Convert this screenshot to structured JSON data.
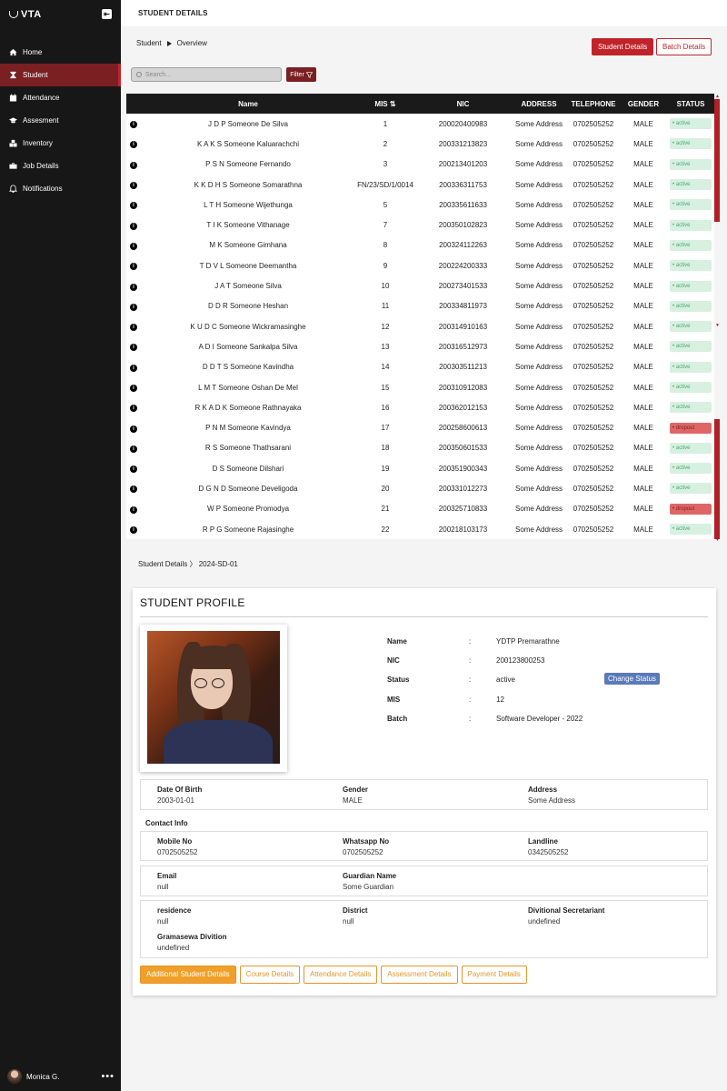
{
  "app": {
    "logo": "VTA"
  },
  "sidebar": {
    "items": [
      {
        "label": "Home",
        "icon": "home-icon"
      },
      {
        "label": "Student",
        "icon": "hourglass-icon"
      },
      {
        "label": "Attendance",
        "icon": "calendar-icon"
      },
      {
        "label": "Assesment",
        "icon": "graduation-cap-icon"
      },
      {
        "label": "Inventory",
        "icon": "boxes-icon"
      },
      {
        "label": "Job Details",
        "icon": "briefcase-icon"
      },
      {
        "label": "Notifications",
        "icon": "bell-icon"
      }
    ],
    "active_index": 1,
    "user": {
      "name": "Monica G.",
      "menu": "•••"
    }
  },
  "header": {
    "title": "STUDENT DETAILS"
  },
  "breadcrumb": {
    "root": "Student",
    "current": "Overview"
  },
  "toolbar": {
    "student_details_label": "Student Details",
    "batch_details_label": "Batch Details",
    "search_placeholder": "Search...",
    "filter_label": "Filter"
  },
  "table": {
    "columns": [
      "",
      "Name",
      "MIS ⇅",
      "NIC",
      "ADDRESS",
      "TELEPHONE",
      "GENDER",
      "STATUS"
    ],
    "rows": [
      {
        "name": "J D P Someone De Silva",
        "mis": "1",
        "nic": "200020400983",
        "address": "Some Address",
        "tel": "0702505252",
        "gender": "MALE",
        "status": "active"
      },
      {
        "name": "K A K S Someone Kaluarachchi",
        "mis": "2",
        "nic": "200331213823",
        "address": "Some Address",
        "tel": "0702505252",
        "gender": "MALE",
        "status": "active"
      },
      {
        "name": "P S N Someone Fernando",
        "mis": "3",
        "nic": "200213401203",
        "address": "Some Address",
        "tel": "0702505252",
        "gender": "MALE",
        "status": "active"
      },
      {
        "name": "K K D H S Someone Somarathna",
        "mis": "FN/23/SD/1/0014",
        "nic": "200336311753",
        "address": "Some Address",
        "tel": "0702505252",
        "gender": "MALE",
        "status": "active"
      },
      {
        "name": "L T H Someone Wijethunga",
        "mis": "5",
        "nic": "200335611633",
        "address": "Some Address",
        "tel": "0702505252",
        "gender": "MALE",
        "status": "active"
      },
      {
        "name": "T I K Someone Vithanage",
        "mis": "7",
        "nic": "200350102823",
        "address": "Some Address",
        "tel": "0702505252",
        "gender": "MALE",
        "status": "active"
      },
      {
        "name": "M K Someone Gimhana",
        "mis": "8",
        "nic": "200324112263",
        "address": "Some Address",
        "tel": "0702505252",
        "gender": "MALE",
        "status": "active"
      },
      {
        "name": "T D V L Someone Deemantha",
        "mis": "9",
        "nic": "200224200333",
        "address": "Some Address",
        "tel": "0702505252",
        "gender": "MALE",
        "status": "active"
      },
      {
        "name": "J A T Someone Silva",
        "mis": "10",
        "nic": "200273401533",
        "address": "Some Address",
        "tel": "0702505252",
        "gender": "MALE",
        "status": "active"
      },
      {
        "name": "D D R Someone Heshan",
        "mis": "11",
        "nic": "200334811973",
        "address": "Some Address",
        "tel": "0702505252",
        "gender": "MALE",
        "status": "active"
      },
      {
        "name": "K U D C Someone Wickramasinghe",
        "mis": "12",
        "nic": "200314910163",
        "address": "Some Address",
        "tel": "0702505252",
        "gender": "MALE",
        "status": "active"
      },
      {
        "name": "A D I Someone Sankalpa Silva",
        "mis": "13",
        "nic": "200316512973",
        "address": "Some Address",
        "tel": "0702505252",
        "gender": "MALE",
        "status": "active"
      },
      {
        "name": "D D T S Someone Kavindha",
        "mis": "14",
        "nic": "200303511213",
        "address": "Some Address",
        "tel": "0702505252",
        "gender": "MALE",
        "status": "active"
      },
      {
        "name": "L M T Someone Oshan De Mel",
        "mis": "15",
        "nic": "200310912083",
        "address": "Some Address",
        "tel": "0702505252",
        "gender": "MALE",
        "status": "active"
      },
      {
        "name": "R K A D K Someone Rathnayaka",
        "mis": "16",
        "nic": "200362012153",
        "address": "Some Address",
        "tel": "0702505252",
        "gender": "MALE",
        "status": "active"
      },
      {
        "name": "P N M Someone Kavindya",
        "mis": "17",
        "nic": "200258600613",
        "address": "Some Address",
        "tel": "0702505252",
        "gender": "MALE",
        "status": "dropout"
      },
      {
        "name": "R S Someone Thathsarani",
        "mis": "18",
        "nic": "200350601533",
        "address": "Some Address",
        "tel": "0702505252",
        "gender": "MALE",
        "status": "active"
      },
      {
        "name": "D S Someone Dilshari",
        "mis": "19",
        "nic": "200351900343",
        "address": "Some Address",
        "tel": "0702505252",
        "gender": "MALE",
        "status": "active"
      },
      {
        "name": "D G N D Someone Develigoda",
        "mis": "20",
        "nic": "200331012273",
        "address": "Some Address",
        "tel": "0702505252",
        "gender": "MALE",
        "status": "active"
      },
      {
        "name": "W P Someone Promodya",
        "mis": "21",
        "nic": "200325710833",
        "address": "Some Address",
        "tel": "0702505252",
        "gender": "MALE",
        "status": "dropout"
      },
      {
        "name": "R P G Someone Rajasinghe",
        "mis": "22",
        "nic": "200218103173",
        "address": "Some Address",
        "tel": "0702505252",
        "gender": "MALE",
        "status": "active"
      }
    ]
  },
  "student_details": {
    "breadcrumb_root": "Student Details",
    "breadcrumb_sep": "〉",
    "breadcrumb_id": "2024-SD-01",
    "title": "STUDENT PROFILE",
    "summary": {
      "name_label": "Name",
      "name": "YDTP Premarathne",
      "nic_label": "NIC",
      "nic": "200123800253",
      "status_label": "Status",
      "status": "active",
      "mis_label": "MIS",
      "mis": "12",
      "batch_label": "Batch",
      "batch": "Software Developer - 2022",
      "sep": ":",
      "change_status_label": "Change Status"
    },
    "personal": {
      "dob_label": "Date Of Birth",
      "dob": "2003-01-01",
      "gender_label": "Gender",
      "gender": "MALE",
      "address_label": "Address",
      "address": "Some Address"
    },
    "contact_title": "Contact Info",
    "contact": {
      "mobile_label": "Mobile No",
      "mobile": "0702505252",
      "whatsapp_label": "Whatsapp No",
      "whatsapp": "0702505252",
      "landline_label": "Landline",
      "landline": "0342505252"
    },
    "email": {
      "email_label": "Email",
      "email": "null",
      "guardian_label": "Guardian Name",
      "guardian": "Some Guardian"
    },
    "residence": {
      "residence_label": "residence",
      "residence": "null",
      "district_label": "District",
      "district": "null",
      "ds_label": "Divitional Secretariant",
      "ds": "undefined",
      "gn_label": "Gramasewa Divition",
      "gn": "undefined"
    },
    "tabs": [
      "Additional Student Details",
      "Course Details",
      "Attendance Details",
      "Assessment Details",
      "Payment Details"
    ]
  },
  "colors": {
    "sidebar": "#171717",
    "accent_red": "#c0232a",
    "dark_red": "#7a1f22",
    "orange": "#f0a028",
    "status_active": "#d7f0e0",
    "status_dropout": "#e06666"
  }
}
